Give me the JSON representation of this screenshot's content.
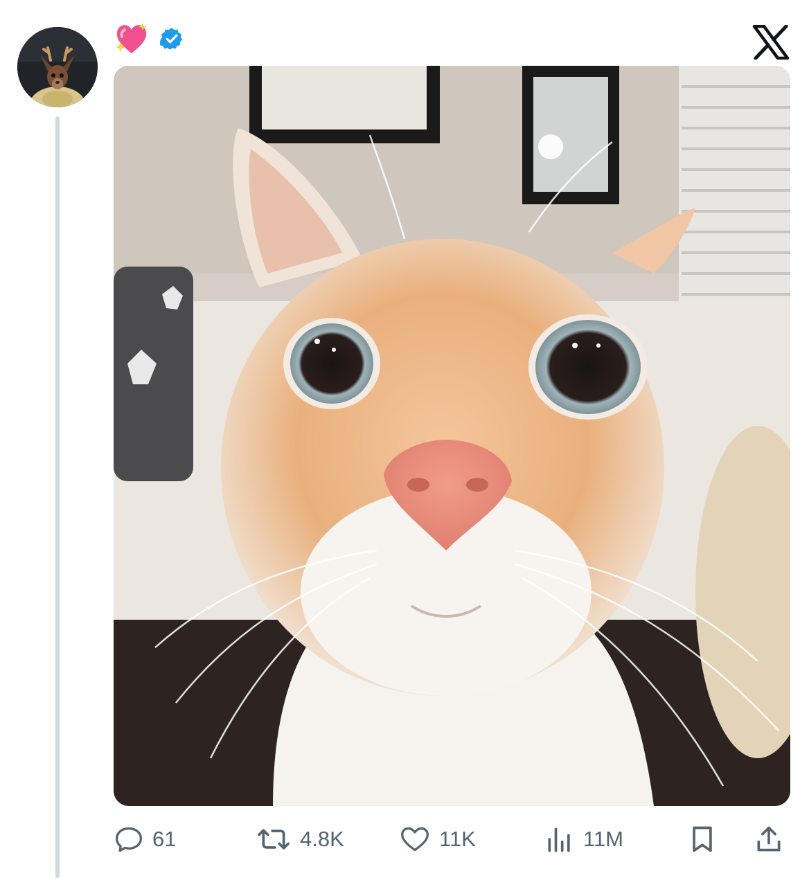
{
  "tweet": {
    "author_avatar": "avatar-chihuahua-with-antlers",
    "header_emoji": "sparkling-heart-emoji",
    "verified_badge": "verified-badge-icon",
    "platform_logo": "x-logo-icon",
    "media": "photo-close-up-orange-white-cat-wide-eyes"
  },
  "actions": {
    "reply": {
      "icon": "reply-bubble-icon",
      "count": "61"
    },
    "repost": {
      "icon": "repost-arrows-icon",
      "count": "4.8K"
    },
    "like": {
      "icon": "heart-icon",
      "count": "11K"
    },
    "views": {
      "icon": "analytics-bars-icon",
      "count": "11M"
    },
    "bookmark": {
      "icon": "bookmark-icon"
    },
    "share": {
      "icon": "share-upload-icon"
    }
  },
  "colors": {
    "text_secondary": "#536471",
    "verified_blue": "#1d9bf0",
    "thread_line": "#cfd9de",
    "logo": "#0f1419"
  }
}
